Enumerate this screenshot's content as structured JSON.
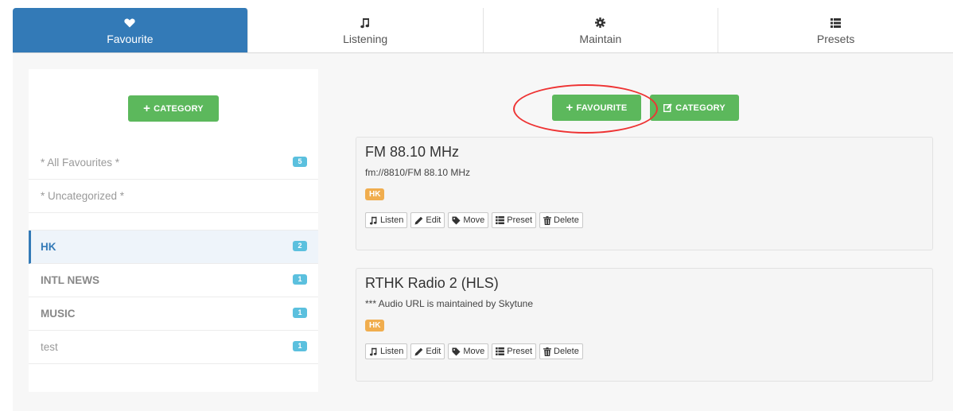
{
  "nav": {
    "tabs": [
      {
        "label": "Favourite",
        "icon": "heart-icon",
        "active": true
      },
      {
        "label": "Listening",
        "icon": "music-note-icon",
        "active": false
      },
      {
        "label": "Maintain",
        "icon": "gear-icon",
        "active": false
      },
      {
        "label": "Presets",
        "icon": "list-icon",
        "active": false
      }
    ]
  },
  "sidebar": {
    "add_category_label": "CATEGORY",
    "items": [
      {
        "label": "* All Favourites *",
        "count": "5"
      },
      {
        "label": "* Uncategorized *",
        "count": ""
      },
      {
        "label": "HK",
        "count": "2",
        "active": true
      },
      {
        "label": "INTL NEWS",
        "count": "1"
      },
      {
        "label": "MUSIC",
        "count": "1"
      },
      {
        "label": "test",
        "count": "1"
      }
    ]
  },
  "main": {
    "add_favourite_label": "FAVOURITE",
    "edit_category_label": "CATEGORY",
    "favourites": [
      {
        "title": "FM 88.10 MHz",
        "subtitle": "fm://8810/FM 88.10 MHz",
        "tag": "HK"
      },
      {
        "title": "RTHK Radio 2 (HLS)",
        "subtitle": "*** Audio URL is maintained by Skytune",
        "tag": "HK"
      }
    ],
    "actions": {
      "listen": "Listen",
      "edit": "Edit",
      "move": "Move",
      "preset": "Preset",
      "delete": "Delete"
    }
  },
  "colors": {
    "primary": "#337ab7",
    "success": "#5cb85c",
    "info_badge": "#5bc0de",
    "warning_tag": "#f0ad4e",
    "annotation_red": "#e33333"
  }
}
